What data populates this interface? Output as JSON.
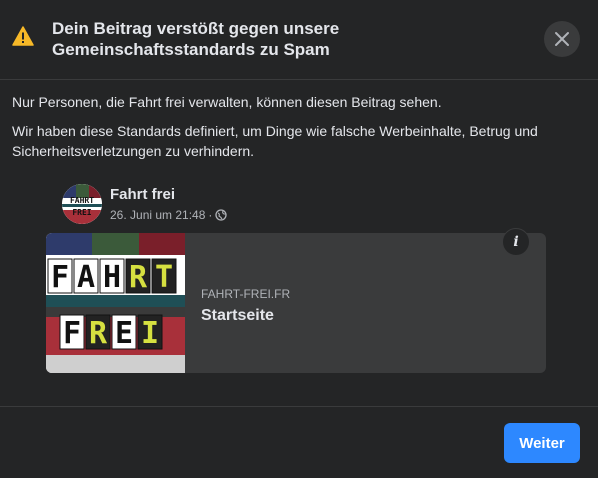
{
  "dialog": {
    "title": "Dein Beitrag verstößt gegen unsere Gemeinschaftsstandards zu Spam",
    "close_icon": "close-icon",
    "warning_icon": "warning-icon"
  },
  "body": {
    "paragraph1": "Nur Personen, die Fahrt frei verwalten, können diesen Beitrag sehen.",
    "paragraph2": "Wir haben diese Standards definiert, um Dinge wie falsche Werbeinhalte, Betrug und Sicherheitsverletzungen zu verhindern."
  },
  "post": {
    "author": "Fahrt frei",
    "date": "26. Juni um 21:48",
    "separator": "·",
    "privacy_icon": "globe-icon",
    "avatar_text_top": "FAHRT",
    "avatar_text_bottom": "FREI"
  },
  "link": {
    "domain": "FAHRT-FREI.FR",
    "title": "Startseite",
    "info_label": "i",
    "thumb_line1": "FAHRT",
    "thumb_line2": "FREI"
  },
  "footer": {
    "next_label": "Weiter"
  },
  "colors": {
    "background": "#242526",
    "card": "#3a3b3c",
    "primary": "#2d88ff",
    "warning": "#f7b928",
    "text": "#e4e6eb",
    "secondary_text": "#b0b3b8"
  }
}
